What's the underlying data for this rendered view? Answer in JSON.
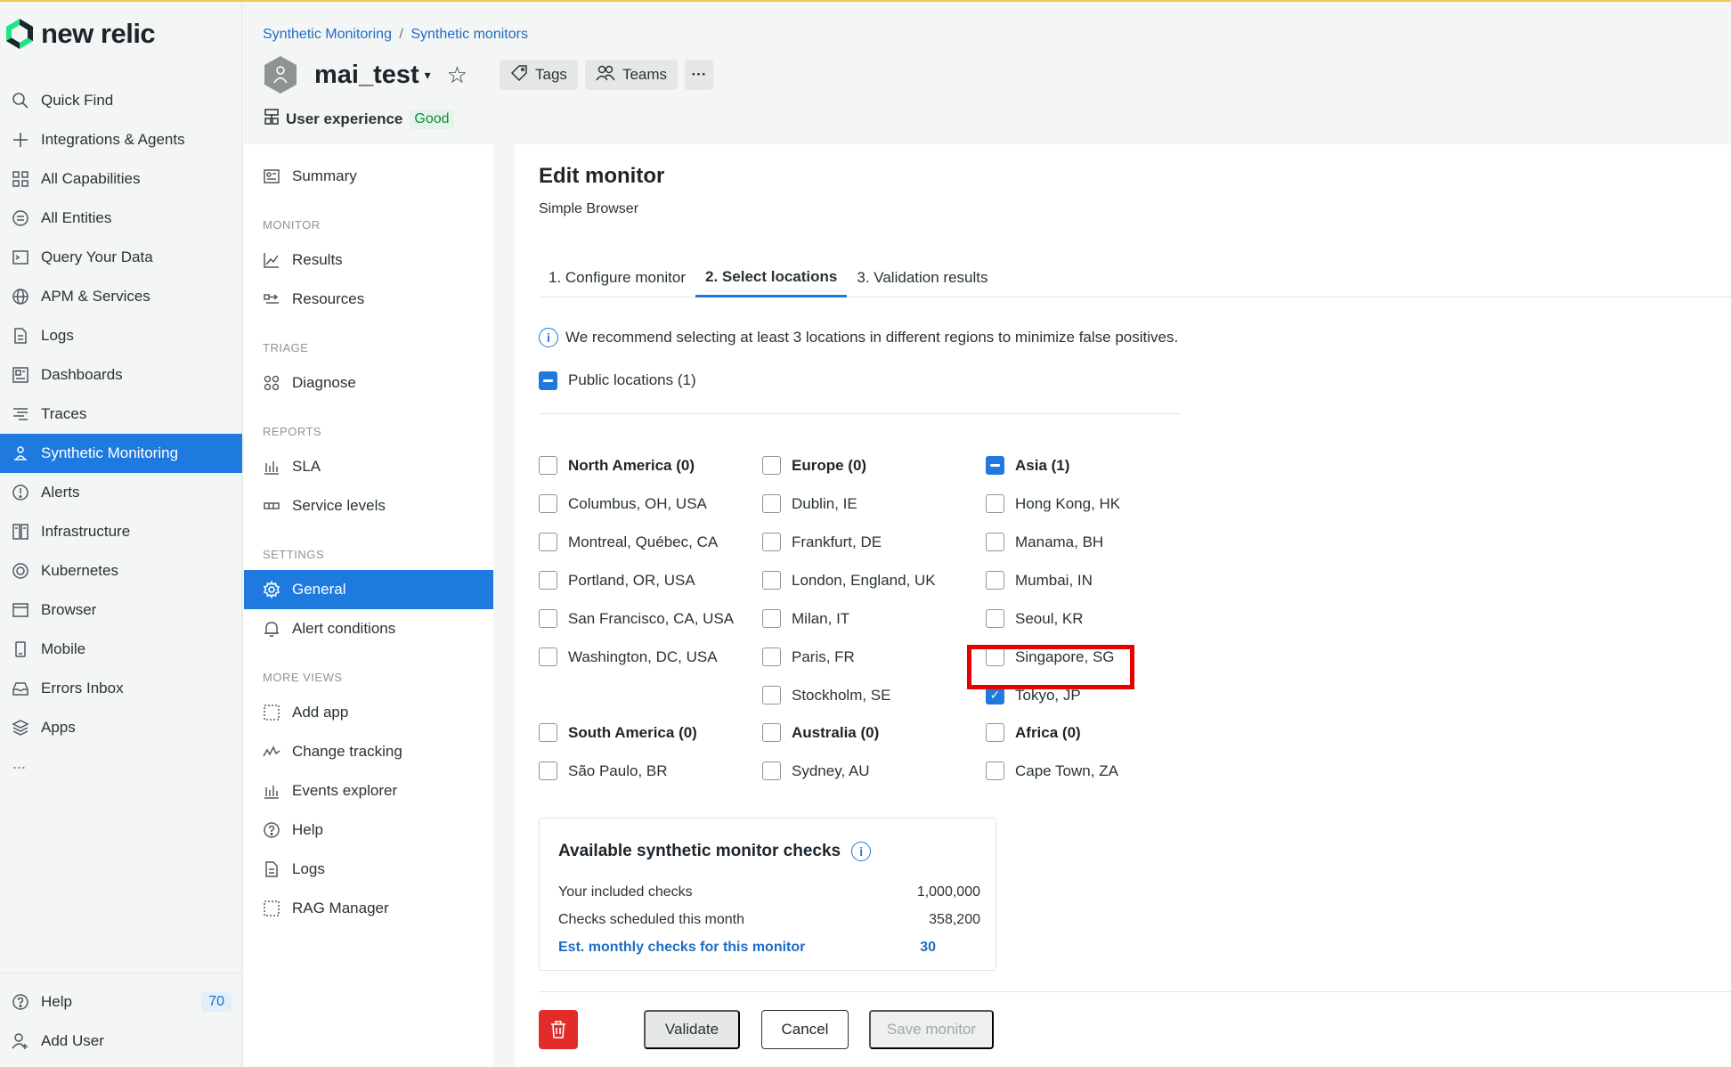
{
  "brand": {
    "logo_text": "new relic",
    "accent": "#1f7ae0",
    "highlight": "#e60000"
  },
  "leftnav": {
    "items": [
      {
        "label": "Quick Find",
        "icon": "search-icon"
      },
      {
        "label": "Integrations & Agents",
        "icon": "plus-icon"
      },
      {
        "label": "All Capabilities",
        "icon": "grid-icon"
      },
      {
        "label": "All Entities",
        "icon": "list-icon"
      },
      {
        "label": "Query Your Data",
        "icon": "terminal-icon"
      },
      {
        "label": "APM & Services",
        "icon": "globe-icon"
      },
      {
        "label": "Logs",
        "icon": "document-icon"
      },
      {
        "label": "Dashboards",
        "icon": "dashboard-icon"
      },
      {
        "label": "Traces",
        "icon": "traces-icon"
      },
      {
        "label": "Synthetic Monitoring",
        "icon": "synthetic-icon"
      },
      {
        "label": "Alerts",
        "icon": "alert-icon"
      },
      {
        "label": "Infrastructure",
        "icon": "infrastructure-icon"
      },
      {
        "label": "Kubernetes",
        "icon": "kubernetes-icon"
      },
      {
        "label": "Browser",
        "icon": "browser-icon"
      },
      {
        "label": "Mobile",
        "icon": "mobile-icon"
      },
      {
        "label": "Errors Inbox",
        "icon": "inbox-icon"
      },
      {
        "label": "Apps",
        "icon": "apps-icon"
      }
    ],
    "more": "...",
    "help_label": "Help",
    "help_badge": "70",
    "add_user_label": "Add User"
  },
  "header": {
    "breadcrumb_1": "Synthetic Monitoring",
    "breadcrumb_sep": "/",
    "breadcrumb_2": "Synthetic monitors",
    "entity_name": "mai_test",
    "tags_label": "Tags",
    "teams_label": "Teams",
    "more_label": "···",
    "ux_label": "User experience",
    "ux_status": "Good"
  },
  "subnav": {
    "summary": "Summary",
    "monitor_section": "MONITOR",
    "results": "Results",
    "resources": "Resources",
    "triage_section": "TRIAGE",
    "diagnose": "Diagnose",
    "reports_section": "REPORTS",
    "sla": "SLA",
    "service_levels": "Service levels",
    "settings_section": "SETTINGS",
    "general": "General",
    "alert_conditions": "Alert conditions",
    "more_views_section": "MORE VIEWS",
    "add_app": "Add app",
    "change_tracking": "Change tracking",
    "events_explorer": "Events explorer",
    "help": "Help",
    "logs": "Logs",
    "rag_manager": "RAG Manager"
  },
  "main": {
    "title": "Edit monitor",
    "subtitle": "Simple Browser",
    "tabs": [
      "1. Configure monitor",
      "2. Select locations",
      "3. Validation results"
    ],
    "info_text": "We recommend selecting at least 3 locations in different regions to minimize false positives.",
    "public_locations": "Public locations (1)",
    "regions": {
      "north_america": {
        "label": "North America (0)",
        "locations": [
          "Columbus, OH, USA",
          "Montreal, Québec, CA",
          "Portland, OR, USA",
          "San Francisco, CA, USA",
          "Washington, DC, USA"
        ]
      },
      "europe": {
        "label": "Europe (0)",
        "locations": [
          "Dublin, IE",
          "Frankfurt, DE",
          "London, England, UK",
          "Milan, IT",
          "Paris, FR",
          "Stockholm, SE"
        ]
      },
      "asia": {
        "label": "Asia (1)",
        "locations": [
          "Hong Kong, HK",
          "Manama, BH",
          "Mumbai, IN",
          "Seoul, KR",
          "Singapore, SG",
          "Tokyo, JP"
        ]
      },
      "south_america": {
        "label": "South America (0)",
        "locations": [
          "São Paulo, BR"
        ]
      },
      "australia": {
        "label": "Australia (0)",
        "locations": [
          "Sydney, AU"
        ]
      },
      "africa": {
        "label": "Africa (0)",
        "locations": [
          "Cape Town, ZA"
        ]
      }
    },
    "checks": {
      "title": "Available synthetic monitor checks",
      "included_label": "Your included checks",
      "included_value": "1,000,000",
      "scheduled_label": "Checks scheduled this month",
      "scheduled_value": "358,200",
      "est_label": "Est. monthly checks for this monitor",
      "est_value": "30"
    },
    "buttons": {
      "validate": "Validate",
      "cancel": "Cancel",
      "save": "Save monitor"
    }
  }
}
